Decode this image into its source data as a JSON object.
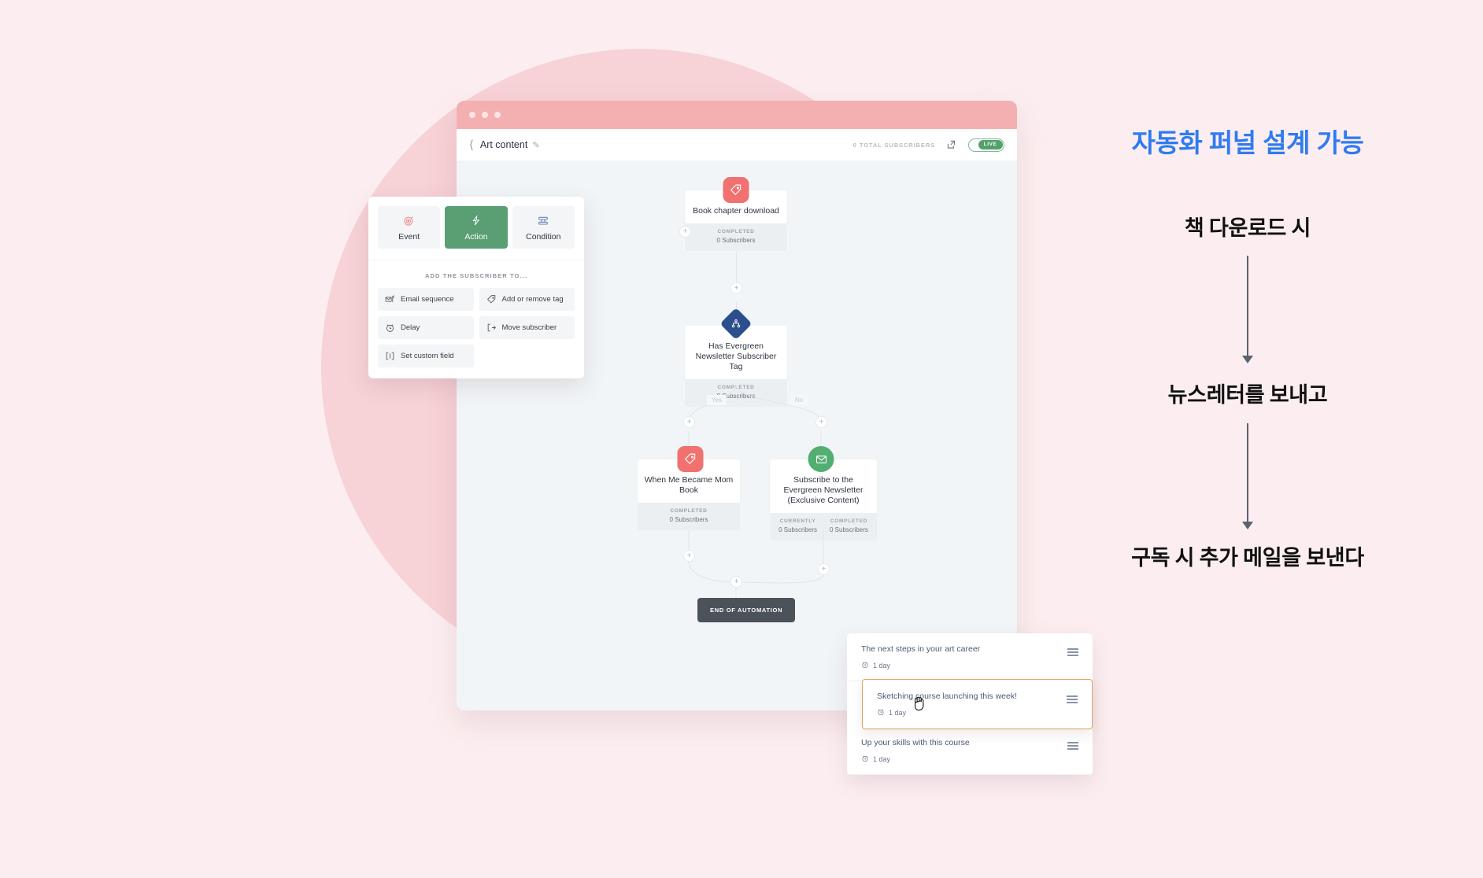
{
  "colors": {
    "page_bg": "#fceef0",
    "blob": "#f7d2d6",
    "titlebar": "#f4b0b1",
    "accent_green": "#5a9e73",
    "accent_red": "#f0716f",
    "accent_blue": "#2b4f8e",
    "heading_blue": "#2f7bf0",
    "drag_highlight": "#e0a355"
  },
  "window": {
    "titlebar": {
      "dots": [
        "dot-1",
        "dot-2",
        "dot-3"
      ]
    },
    "appbar": {
      "back_icon": "chevron-left-icon",
      "title": "Art content",
      "edit_icon": "pencil-icon",
      "subscribers_count": "0 TOTAL SUBSCRIBERS",
      "share_icon": "share-icon",
      "toggle_label": "LIVE"
    }
  },
  "flow": {
    "nodes": [
      {
        "id": "book-chapter-download",
        "icon": "tag-icon",
        "icon_color": "red",
        "title": "Book chapter download",
        "stats": [
          {
            "label": "COMPLETED",
            "value": "0 Subscribers"
          }
        ]
      },
      {
        "id": "has-evergreen-newsletter-subscriber-tag",
        "icon": "condition-branch-icon",
        "icon_color": "blue",
        "title": "Has Evergreen Newsletter Subscriber Tag",
        "stats": [
          {
            "label": "COMPLETED",
            "value": "0 Subscribers"
          }
        ]
      },
      {
        "id": "when-me-became-mom-book",
        "icon": "tag-icon",
        "icon_color": "red",
        "title": "When Me Became Mom Book",
        "stats": [
          {
            "label": "COMPLETED",
            "value": "0 Subscribers"
          }
        ]
      },
      {
        "id": "subscribe-evergreen-newsletter",
        "icon": "envelope-icon",
        "icon_color": "green",
        "title": "Subscribe to the Evergreen Newsletter (Exclusive Content)",
        "stats": [
          {
            "label": "CURRENTLY",
            "value": "0 Subscribers"
          },
          {
            "label": "COMPLETED",
            "value": "0 Subscribers"
          }
        ]
      }
    ],
    "branch_labels": {
      "yes": "Yes",
      "no": "No"
    },
    "add_button_glyph": "+",
    "end_button_label": "END OF AUTOMATION"
  },
  "action_panel": {
    "tabs": [
      {
        "id": "event",
        "label": "Event",
        "icon": "target-icon",
        "active": false
      },
      {
        "id": "action",
        "label": "Action",
        "icon": "lightning-icon",
        "active": true
      },
      {
        "id": "condition",
        "label": "Condition",
        "icon": "condition-icon",
        "active": false
      }
    ],
    "section_title": "ADD THE SUBSCRIBER TO...",
    "options": [
      {
        "id": "email-sequence",
        "label": "Email sequence",
        "icon": "email-sequence-icon"
      },
      {
        "id": "add-or-remove-tag",
        "label": "Add or remove tag",
        "icon": "tag-icon"
      },
      {
        "id": "delay",
        "label": "Delay",
        "icon": "alarm-clock-icon"
      },
      {
        "id": "move-subscriber",
        "label": "Move subscriber",
        "icon": "move-arrow-icon"
      },
      {
        "id": "set-custom-field",
        "label": "Set custom field",
        "icon": "custom-field-icon"
      }
    ]
  },
  "email_list": {
    "rows": [
      {
        "id": "row-1",
        "subject": "The next steps in your art career",
        "delay": "1 day",
        "delay_icon": "alarm-clock-icon",
        "grip_icon": "drag-handle-icon",
        "dragging": false
      },
      {
        "id": "row-2",
        "subject": "Sketching course launching this week!",
        "delay": "1 day",
        "delay_icon": "alarm-clock-icon",
        "grip_icon": "drag-handle-icon",
        "dragging": true
      },
      {
        "id": "row-3",
        "subject": "Up your skills with this course",
        "delay": "1 day",
        "delay_icon": "alarm-clock-icon",
        "grip_icon": "drag-handle-icon",
        "dragging": false
      }
    ],
    "cursor_icon": "grabbing-hand-cursor"
  },
  "annotations": {
    "heading": "자동화 퍼널 설계 가능",
    "step1": "책 다운로드 시",
    "step2": "뉴스레터를 보내고",
    "step3": "구독 시 추가 메일을 보낸다",
    "arrow_icon": "arrow-down-icon"
  }
}
